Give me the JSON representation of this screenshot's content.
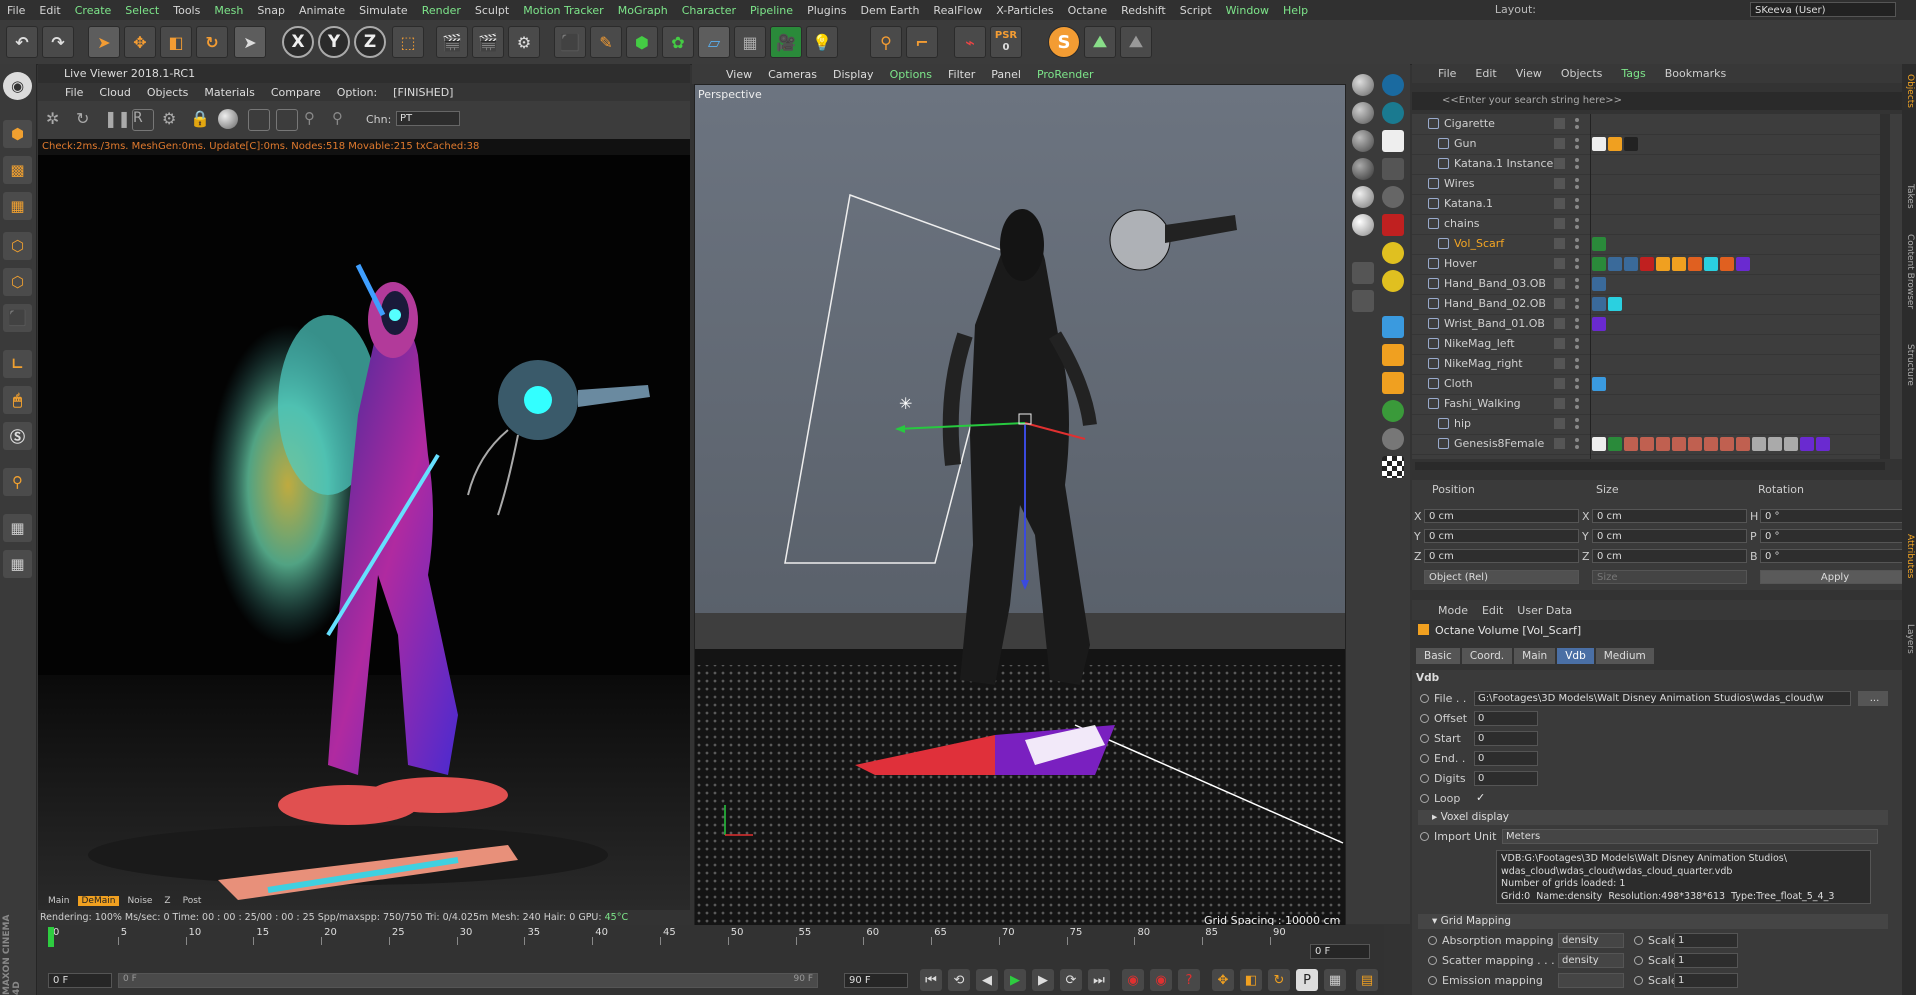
{
  "menubar": {
    "items": [
      {
        "label": "File",
        "accent": false
      },
      {
        "label": "Edit",
        "accent": false
      },
      {
        "label": "Create",
        "accent": true
      },
      {
        "label": "Select",
        "accent": true
      },
      {
        "label": "Tools",
        "accent": false
      },
      {
        "label": "Mesh",
        "accent": true
      },
      {
        "label": "Snap",
        "accent": false
      },
      {
        "label": "Animate",
        "accent": false
      },
      {
        "label": "Simulate",
        "accent": false
      },
      {
        "label": "Render",
        "accent": true
      },
      {
        "label": "Sculpt",
        "accent": false
      },
      {
        "label": "Motion Tracker",
        "accent": true
      },
      {
        "label": "MoGraph",
        "accent": true
      },
      {
        "label": "Character",
        "accent": true
      },
      {
        "label": "Pipeline",
        "accent": true
      },
      {
        "label": "Plugins",
        "accent": false
      },
      {
        "label": "Dem Earth",
        "accent": false
      },
      {
        "label": "RealFlow",
        "accent": false
      },
      {
        "label": "X-Particles",
        "accent": false
      },
      {
        "label": "Octane",
        "accent": false
      },
      {
        "label": "Redshift",
        "accent": false
      },
      {
        "label": "Script",
        "accent": false
      },
      {
        "label": "Window",
        "accent": true
      },
      {
        "label": "Help",
        "accent": true
      }
    ],
    "layout_label": "Layout:",
    "layout_value": "SKeeva (User)"
  },
  "toolbar": {
    "x_label": "X",
    "y_label": "Y",
    "z_label": "Z",
    "psr_label": "PSR",
    "psr_value": "0",
    "s_label": "S"
  },
  "live_viewer": {
    "title": "Live Viewer 2018.1-RC1",
    "menu": [
      "File",
      "Cloud",
      "Objects",
      "Materials",
      "Compare",
      "Option:"
    ],
    "finished": "[FINISHED]",
    "chn_label": "Chn:",
    "chn_value": "PT",
    "status": "Check:2ms./3ms. MeshGen:0ms. Update[C]:0ms. Nodes:518 Movable:215 txCached:38",
    "tabs": [
      "Main",
      "DeMain",
      "Noise",
      "Z",
      "Post"
    ],
    "stats": "Rendering: 100%  Ms/sec: 0    Time: 00 : 00 : 25/00 : 00 : 25  Spp/maxspp: 750/750    Tri: 0/4.025m    Mesh: 240   Hair: 0     GPU:",
    "temp": "45°C"
  },
  "viewport": {
    "menu": [
      {
        "label": "View",
        "accent": false
      },
      {
        "label": "Cameras",
        "accent": false
      },
      {
        "label": "Display",
        "accent": false
      },
      {
        "label": "Options",
        "accent": true
      },
      {
        "label": "Filter",
        "accent": false
      },
      {
        "label": "Panel",
        "accent": false
      },
      {
        "label": "ProRender",
        "accent": true
      }
    ],
    "label": "Perspective",
    "grid_spacing": "Grid Spacing : 10000 cm"
  },
  "object_manager": {
    "menu": [
      {
        "label": "File",
        "accent": false
      },
      {
        "label": "Edit",
        "accent": false
      },
      {
        "label": "View",
        "accent": false
      },
      {
        "label": "Objects",
        "accent": false
      },
      {
        "label": "Tags",
        "accent": true
      },
      {
        "label": "Bookmarks",
        "accent": false
      }
    ],
    "search_placeholder": "<<Enter your search string here>>",
    "objects": [
      {
        "name": "Cigarette",
        "indent": 0,
        "highlight": false
      },
      {
        "name": "Gun",
        "indent": 1,
        "highlight": false
      },
      {
        "name": "Katana.1 Instance",
        "indent": 1,
        "highlight": false
      },
      {
        "name": "Wires",
        "indent": 0,
        "highlight": false
      },
      {
        "name": "Katana.1",
        "indent": 0,
        "highlight": false
      },
      {
        "name": "chains",
        "indent": 0,
        "highlight": false
      },
      {
        "name": "Vol_Scarf",
        "indent": 1,
        "highlight": true
      },
      {
        "name": "Hover",
        "indent": 0,
        "highlight": false
      },
      {
        "name": "Hand_Band_03.OB",
        "indent": 0,
        "highlight": false
      },
      {
        "name": "Hand_Band_02.OB",
        "indent": 0,
        "highlight": false
      },
      {
        "name": "Wrist_Band_01.OB",
        "indent": 0,
        "highlight": false
      },
      {
        "name": "NikeMag_left",
        "indent": 0,
        "highlight": false
      },
      {
        "name": "NikeMag_right",
        "indent": 0,
        "highlight": false
      },
      {
        "name": "Cloth",
        "indent": 0,
        "highlight": false
      },
      {
        "name": "Fashi_Walking",
        "indent": 0,
        "highlight": false
      },
      {
        "name": "hip",
        "indent": 1,
        "highlight": false
      },
      {
        "name": "Genesis8Female",
        "indent": 1,
        "highlight": false
      }
    ]
  },
  "coordinates": {
    "headers": [
      "Position",
      "Size",
      "Rotation"
    ],
    "rows": [
      {
        "axis": "X",
        "pos": "0 cm",
        "size_axis": "X",
        "size": "0 cm",
        "rot_axis": "H",
        "rot": "0 °"
      },
      {
        "axis": "Y",
        "pos": "0 cm",
        "size_axis": "Y",
        "size": "0 cm",
        "rot_axis": "P",
        "rot": "0 °"
      },
      {
        "axis": "Z",
        "pos": "0 cm",
        "size_axis": "Z",
        "size": "0 cm",
        "rot_axis": "B",
        "rot": "0 °"
      }
    ],
    "mode": "Object (Rel)",
    "size_mode": "Size",
    "apply": "Apply"
  },
  "attributes": {
    "menu": [
      "Mode",
      "Edit",
      "User Data"
    ],
    "title": "Octane Volume [Vol_Scarf]",
    "tabs": [
      {
        "label": "Basic",
        "selected": false
      },
      {
        "label": "Coord.",
        "selected": false
      },
      {
        "label": "Main",
        "selected": false
      },
      {
        "label": "Vdb",
        "selected": true
      },
      {
        "label": "Medium",
        "selected": false
      }
    ],
    "section": "Vdb",
    "file_label": "File . .",
    "file_value": "G:\\Footages\\3D Models\\Walt Disney Animation Studios\\wdas_cloud\\w",
    "file_button": "...",
    "offset_label": "Offset",
    "offset_value": "0",
    "start_label": "Start",
    "start_value": "0",
    "end_label": "End. .",
    "end_value": "0",
    "digits_label": "Digits",
    "digits_value": "0",
    "loop_label": "Loop",
    "loop_value": "✓",
    "voxel_display": "Voxel display",
    "import_unit_label": "Import Unit",
    "import_unit_value": "Meters",
    "vdb_info": "VDB:G:\\Footages\\3D Models\\Walt Disney Animation Studios\\\nwdas_cloud\\wdas_cloud\\wdas_cloud_quarter.vdb\nNumber of grids loaded: 1\nGrid:0  Name:density  Resolution:498*338*613  Type:Tree_float_5_4_3",
    "grid_mapping": "Grid Mapping",
    "absorption_label": "Absorption mapping",
    "absorption_value": "density",
    "absorption_scale_label": "Scale",
    "absorption_scale": "1",
    "scatter_label": "Scatter mapping . . .",
    "scatter_value": "density",
    "scatter_scale_label": "Scale",
    "scatter_scale": "1",
    "emission_label": "Emission mapping",
    "emission_value": "",
    "emission_scale_label": "Scale",
    "emission_scale": "1"
  },
  "right_tabs": [
    {
      "label": "Objects",
      "selected": true
    },
    {
      "label": "Takes",
      "selected": false
    },
    {
      "label": "Content Browser",
      "selected": false
    },
    {
      "label": "Structure",
      "selected": false
    },
    {
      "label": "Attributes",
      "selected": true
    },
    {
      "label": "Layers",
      "selected": false
    }
  ],
  "timeline": {
    "ticks": [
      "0",
      "5",
      "10",
      "15",
      "20",
      "25",
      "30",
      "35",
      "40",
      "45",
      "50",
      "55",
      "60",
      "65",
      "70",
      "75",
      "80",
      "85",
      "90"
    ],
    "current_frame": "0 F",
    "start_field": "0 F",
    "range_start": "0 F",
    "range_end": "90 F",
    "end_field": "90 F"
  },
  "brand": "MAXON CINEMA 4D"
}
